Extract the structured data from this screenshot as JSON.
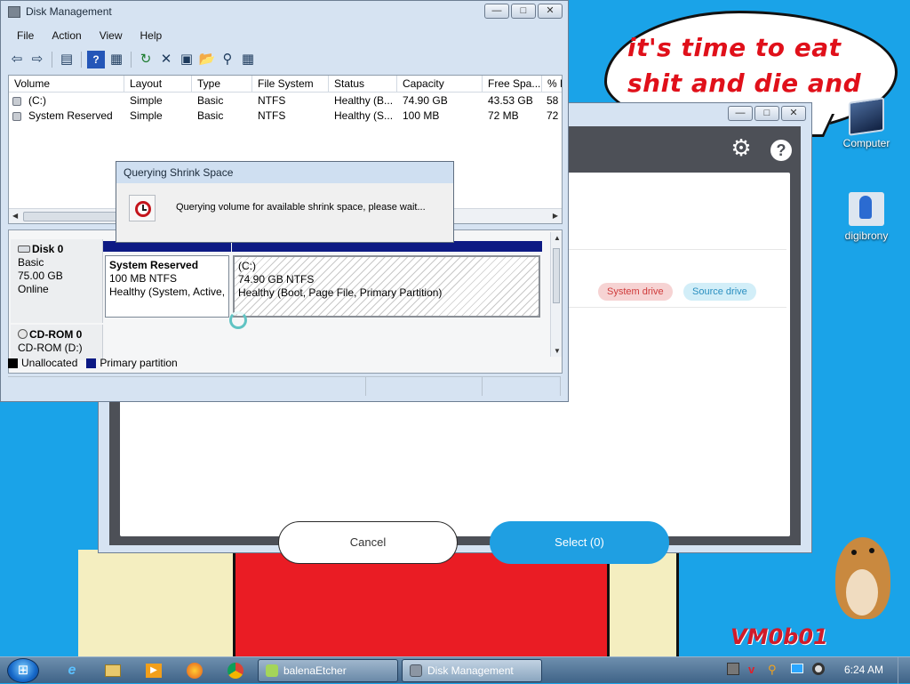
{
  "desktop": {
    "speech_text": "it's time to eat shit and die and chew",
    "watermark": "VM0b01",
    "icons": [
      {
        "label": "Computer",
        "icon": "computer-icon"
      },
      {
        "label": "digibrony",
        "icon": "user-folder-icon"
      }
    ]
  },
  "etcher": {
    "title": "",
    "tags": {
      "system": "System drive",
      "source": "Source drive"
    },
    "cancel_label": "Cancel",
    "select_label": "Select (0)",
    "icons": [
      "gear-icon",
      "help-icon"
    ]
  },
  "disk_management": {
    "title": "Disk Management",
    "menu": [
      "File",
      "Action",
      "View",
      "Help"
    ],
    "columns": [
      "Volume",
      "Layout",
      "Type",
      "File System",
      "Status",
      "Capacity",
      "Free Spa...",
      "% F"
    ],
    "volumes": [
      {
        "volume": "(C:)",
        "layout": "Simple",
        "type": "Basic",
        "fs": "NTFS",
        "status": "Healthy (B...",
        "capacity": "74.90 GB",
        "free": "43.53 GB",
        "pct": "58"
      },
      {
        "volume": "System Reserved",
        "layout": "Simple",
        "type": "Basic",
        "fs": "NTFS",
        "status": "Healthy (S...",
        "capacity": "100 MB",
        "free": "72 MB",
        "pct": "72"
      }
    ],
    "disks": [
      {
        "name": "Disk 0",
        "kind": "Basic",
        "size": "75.00 GB",
        "state": "Online"
      },
      {
        "name": "CD-ROM 0",
        "kind": "CD-ROM (D:)"
      }
    ],
    "partitions": [
      {
        "name": "System Reserved",
        "size": "100 MB NTFS",
        "status": "Healthy (System, Active,"
      },
      {
        "name": "(C:)",
        "size": "74.90 GB NTFS",
        "status": "Healthy (Boot, Page File, Primary Partition)"
      }
    ],
    "legend": {
      "unallocated": "Unallocated",
      "primary": "Primary partition"
    },
    "colors": {
      "unallocated": "#000000",
      "primary": "#0d1a84"
    }
  },
  "query_dialog": {
    "title": "Querying Shrink Space",
    "message": "Querying volume for available shrink space, please wait..."
  },
  "taskbar": {
    "tasks": [
      {
        "label": "balenaEtcher"
      },
      {
        "label": "Disk Management"
      }
    ],
    "clock": "6:24 AM"
  }
}
